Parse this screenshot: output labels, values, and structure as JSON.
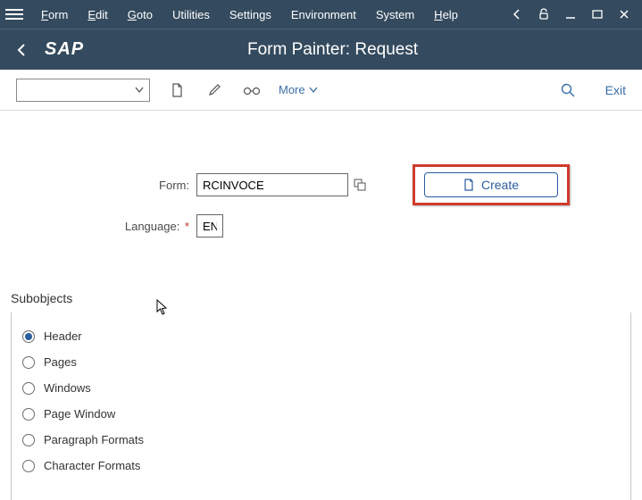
{
  "menu": {
    "items": [
      "Form",
      "Edit",
      "Goto",
      "Utilities",
      "Settings",
      "Environment",
      "System",
      "Help"
    ]
  },
  "header": {
    "logo": "SAP",
    "title": "Form Painter: Request"
  },
  "toolbar": {
    "combo_value": "",
    "more_label": "More",
    "exit_label": "Exit"
  },
  "fields": {
    "form_label": "Form:",
    "form_value": "RCINVOCE",
    "language_label": "Language:",
    "language_value": "EN",
    "create_label": "Create"
  },
  "subobjects": {
    "heading": "Subobjects",
    "options": [
      {
        "label": "Header",
        "checked": true
      },
      {
        "label": "Pages",
        "checked": false
      },
      {
        "label": "Windows",
        "checked": false
      },
      {
        "label": "Page Window",
        "checked": false
      },
      {
        "label": "Paragraph Formats",
        "checked": false
      },
      {
        "label": "Character Formats",
        "checked": false
      }
    ]
  }
}
